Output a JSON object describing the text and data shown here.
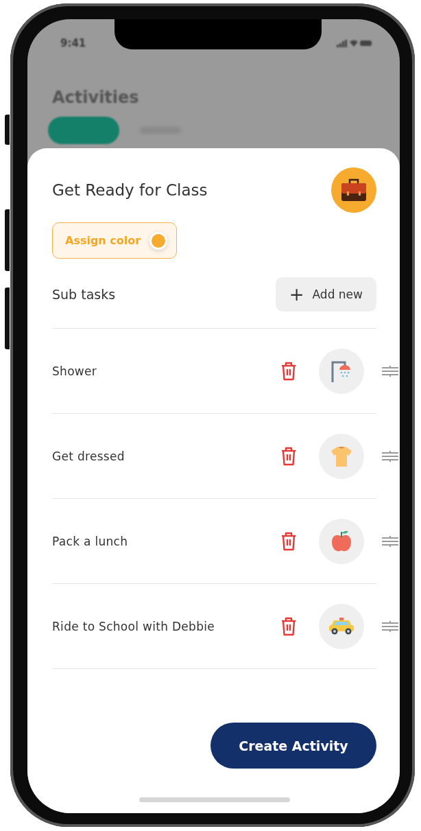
{
  "background": {
    "time": "9:41",
    "title": "Activities"
  },
  "sheet": {
    "title": "Get Ready for Class",
    "activity_icon": {
      "kind": "briefcase"
    },
    "assign_color": {
      "label": "Assign color",
      "color": "#f7ab2e"
    },
    "subtasks_label": "Sub tasks",
    "add_button": {
      "icon": "+",
      "label": "Add new"
    },
    "tasks": [
      {
        "name": "Shower",
        "kind": "shower"
      },
      {
        "name": "Get dressed",
        "kind": "shirt"
      },
      {
        "name": "Pack a lunch",
        "kind": "apple"
      },
      {
        "name": "Ride to School with Debbie",
        "kind": "taxi"
      }
    ],
    "create_button": "Create Activity"
  }
}
